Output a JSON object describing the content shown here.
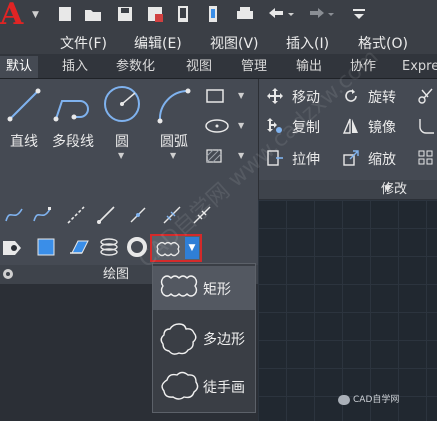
{
  "app": {
    "logo_text": "A",
    "brand_color": "#e02424"
  },
  "menubar": [
    "文件(F)",
    "编辑(E)",
    "视图(V)",
    "插入(I)",
    "格式(O)"
  ],
  "ribbon_tabs": [
    "默认",
    "插入",
    "参数化",
    "视图",
    "管理",
    "输出",
    "协作",
    "Expre"
  ],
  "active_tab": "默认",
  "draw_panel": {
    "title": "绘图",
    "big_buttons": [
      "直线",
      "多段线",
      "圆",
      "圆弧"
    ]
  },
  "modify_panel": {
    "title": "修改",
    "items": [
      "移动",
      "旋转",
      "复制",
      "镜像",
      "拉伸",
      "缩放"
    ]
  },
  "revcloud_dropdown": {
    "items": [
      "矩形",
      "多边形",
      "徒手画"
    ],
    "selected": "矩形"
  },
  "highlight_color": "#d42a2a",
  "watermark": "CAD自学网 www.cadzxw.com",
  "badge": "CAD自学网"
}
